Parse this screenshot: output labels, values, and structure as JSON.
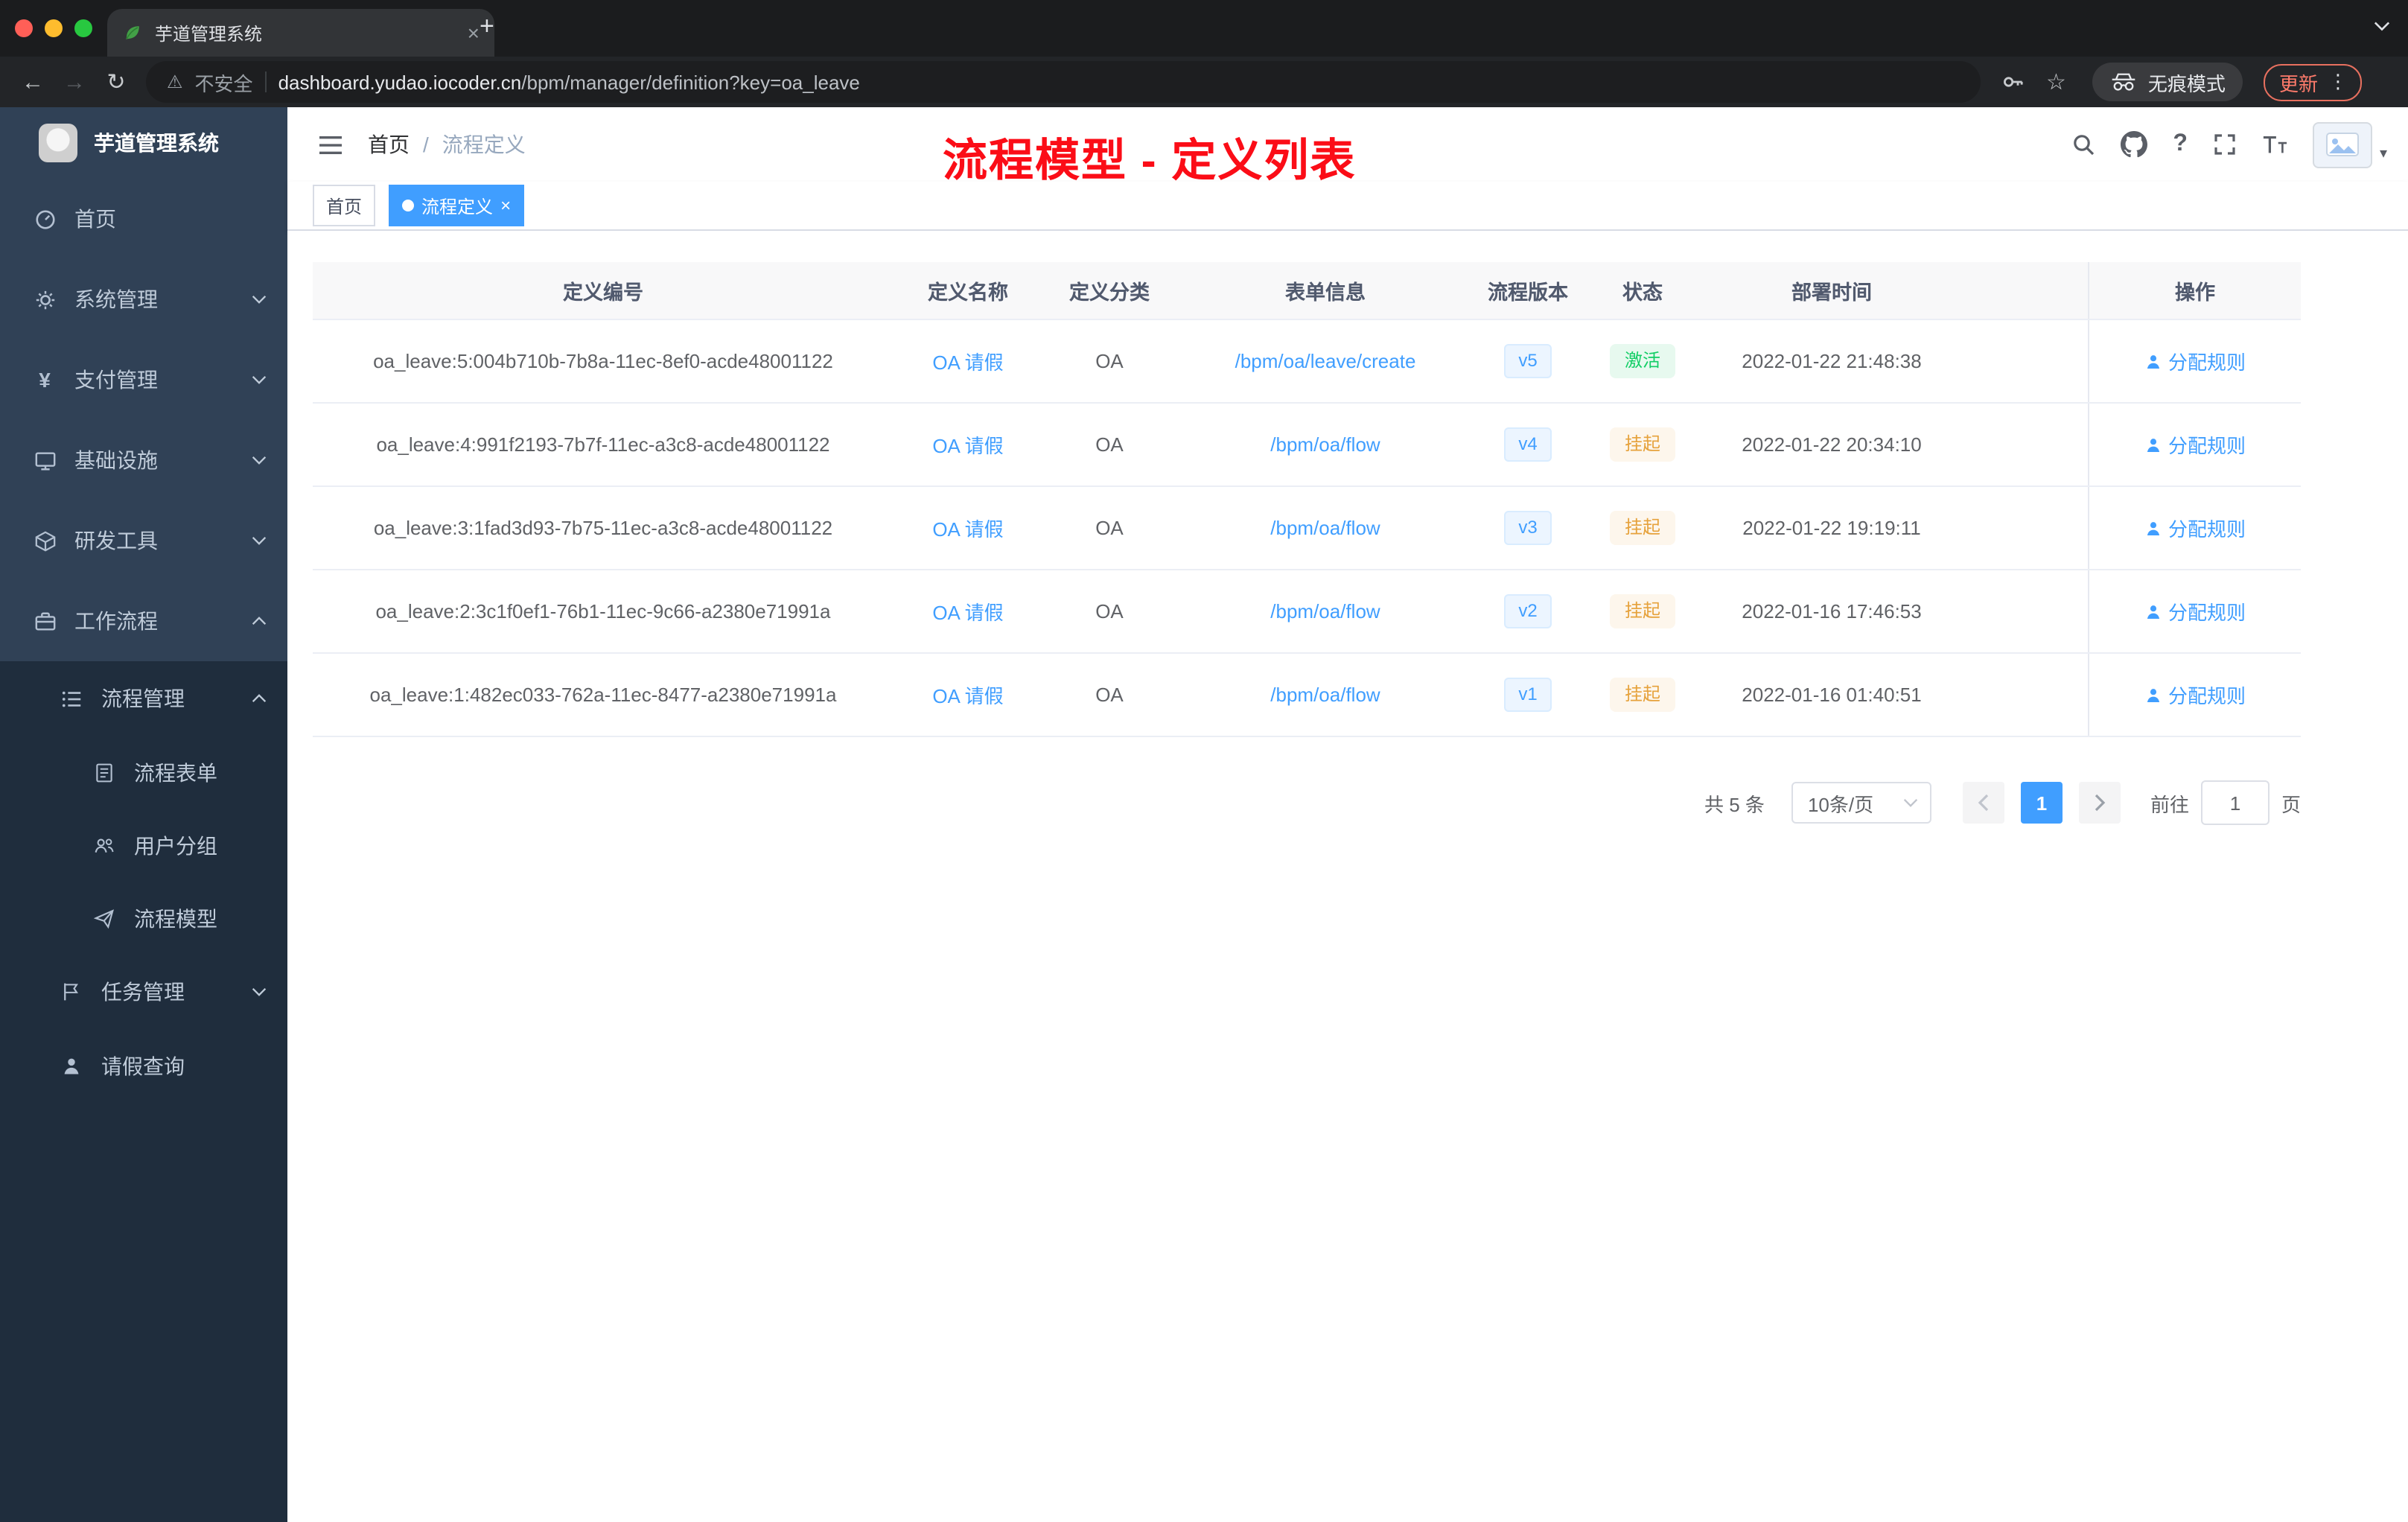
{
  "colors": {
    "accent": "#409eff",
    "annotation_red": "#fb0d17",
    "sidebar_bg": "#304156",
    "submenu_bg": "#1f2d3d",
    "status_active_text": "#13ce66",
    "status_active_bg": "#e7f9ef",
    "status_suspended_text": "#e6a23c",
    "status_suspended_bg": "#fdf6ec",
    "version_text": "#409eff",
    "version_bg": "#ecf5ff"
  },
  "icons": {
    "back": "←",
    "forward": "→",
    "reload": "↻",
    "warning": "⚠",
    "star": "☆",
    "kebab": "⋮",
    "plus": "+",
    "close": "×",
    "question": "?",
    "caret_down": "▾",
    "yen": "¥"
  },
  "browser": {
    "tab_title": "芋道管理系统",
    "security_label": "不安全",
    "url_domain": "dashboard.yudao.iocoder.cn",
    "url_path": "/bpm/manager/definition?key=oa_leave",
    "incognito_label": "无痕模式",
    "update_label": "更新"
  },
  "sidebar": {
    "app_title": "芋道管理系统",
    "items": [
      {
        "label": "首页"
      },
      {
        "label": "系统管理"
      },
      {
        "label": "支付管理"
      },
      {
        "label": "基础设施"
      },
      {
        "label": "研发工具"
      },
      {
        "label": "工作流程"
      },
      {
        "label": "流程管理"
      },
      {
        "label": "流程表单"
      },
      {
        "label": "用户分组"
      },
      {
        "label": "流程模型"
      },
      {
        "label": "任务管理"
      },
      {
        "label": "请假查询"
      }
    ]
  },
  "navbar": {
    "breadcrumb": [
      "首页",
      "流程定义"
    ],
    "annotation": "流程模型 - 定义列表"
  },
  "tags": [
    {
      "label": "首页"
    },
    {
      "label": "流程定义"
    }
  ],
  "table": {
    "headers": [
      "定义编号",
      "定义名称",
      "定义分类",
      "表单信息",
      "流程版本",
      "状态",
      "部署时间",
      "操作"
    ],
    "rows": [
      {
        "id": "oa_leave:5:004b710b-7b8a-11ec-8ef0-acde48001122",
        "name": "OA 请假",
        "category": "OA",
        "form": "/bpm/oa/leave/create",
        "version": "v5",
        "status": "激活",
        "time": "2022-01-22 21:48:38",
        "action": "分配规则"
      },
      {
        "id": "oa_leave:4:991f2193-7b7f-11ec-a3c8-acde48001122",
        "name": "OA 请假",
        "category": "OA",
        "form": "/bpm/oa/flow",
        "version": "v4",
        "status": "挂起",
        "time": "2022-01-22 20:34:10",
        "action": "分配规则"
      },
      {
        "id": "oa_leave:3:1fad3d93-7b75-11ec-a3c8-acde48001122",
        "name": "OA 请假",
        "category": "OA",
        "form": "/bpm/oa/flow",
        "version": "v3",
        "status": "挂起",
        "time": "2022-01-22 19:19:11",
        "action": "分配规则"
      },
      {
        "id": "oa_leave:2:3c1f0ef1-76b1-11ec-9c66-a2380e71991a",
        "name": "OA 请假",
        "category": "OA",
        "form": "/bpm/oa/flow",
        "version": "v2",
        "status": "挂起",
        "time": "2022-01-16 17:46:53",
        "action": "分配规则"
      },
      {
        "id": "oa_leave:1:482ec033-762a-11ec-8477-a2380e71991a",
        "name": "OA 请假",
        "category": "OA",
        "form": "/bpm/oa/flow",
        "version": "v1",
        "status": "挂起",
        "time": "2022-01-16 01:40:51",
        "action": "分配规则"
      }
    ]
  },
  "pagination": {
    "total": "共 5 条",
    "page_size": "10条/页",
    "current": "1",
    "goto_label": "前往",
    "goto_value": "1",
    "page_unit": "页"
  }
}
